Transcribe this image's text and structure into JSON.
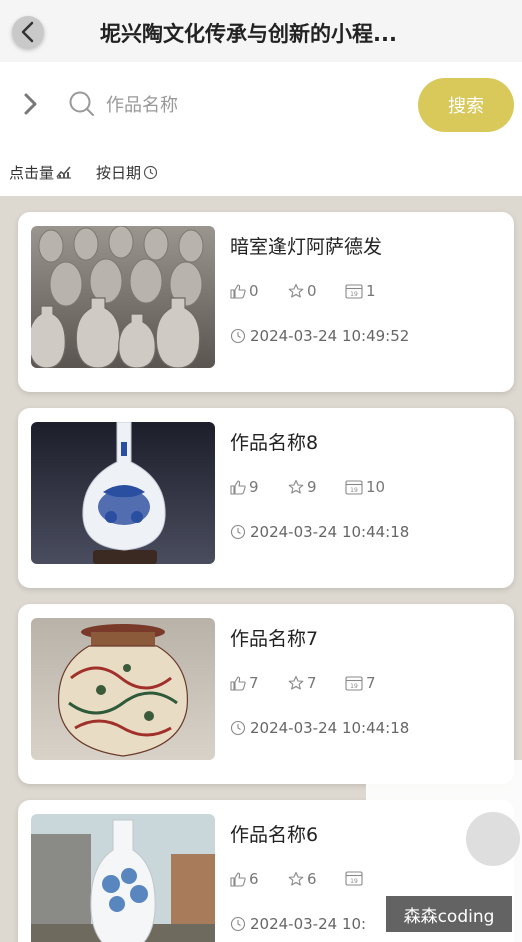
{
  "header": {
    "back_icon": "chevron-left-icon",
    "title": "坭兴陶文化传承与创新的小程..."
  },
  "search": {
    "expand_icon": "chevron-right-icon",
    "search_icon": "search-icon",
    "placeholder": "作品名称",
    "value": "",
    "button_label": "搜索",
    "button_color": "#d9c85a"
  },
  "sort": {
    "by_clicks": "点击量",
    "by_clicks_icon": "trend-chart-icon",
    "by_date": "按日期",
    "by_date_icon": "clock-icon"
  },
  "works": [
    {
      "title": "暗室逢灯阿萨德发",
      "likes": "0",
      "favorites": "0",
      "views": "1",
      "date": "2024-03-24 10:49:52",
      "image": "grey-clay-vases"
    },
    {
      "title": "作品名称8",
      "likes": "9",
      "favorites": "9",
      "views": "10",
      "date": "2024-03-24 10:44:18",
      "image": "blue-white-porcelain-vase"
    },
    {
      "title": "作品名称7",
      "likes": "7",
      "favorites": "7",
      "views": "7",
      "date": "2024-03-24 10:44:18",
      "image": "painted-dragon-jar"
    },
    {
      "title": "作品名称6",
      "likes": "6",
      "favorites": "6",
      "views": "",
      "date": "2024-03-24 10:",
      "image": "white-vase-with-blue-flowers"
    }
  ],
  "stat_icons": {
    "likes": "thumbs-up-icon",
    "favorites": "star-icon",
    "views": "calendar-icon",
    "date": "clock-icon"
  },
  "watermark": "森森coding",
  "colors": {
    "accent": "#d9c85a",
    "list_background": "#ddd8d0"
  }
}
